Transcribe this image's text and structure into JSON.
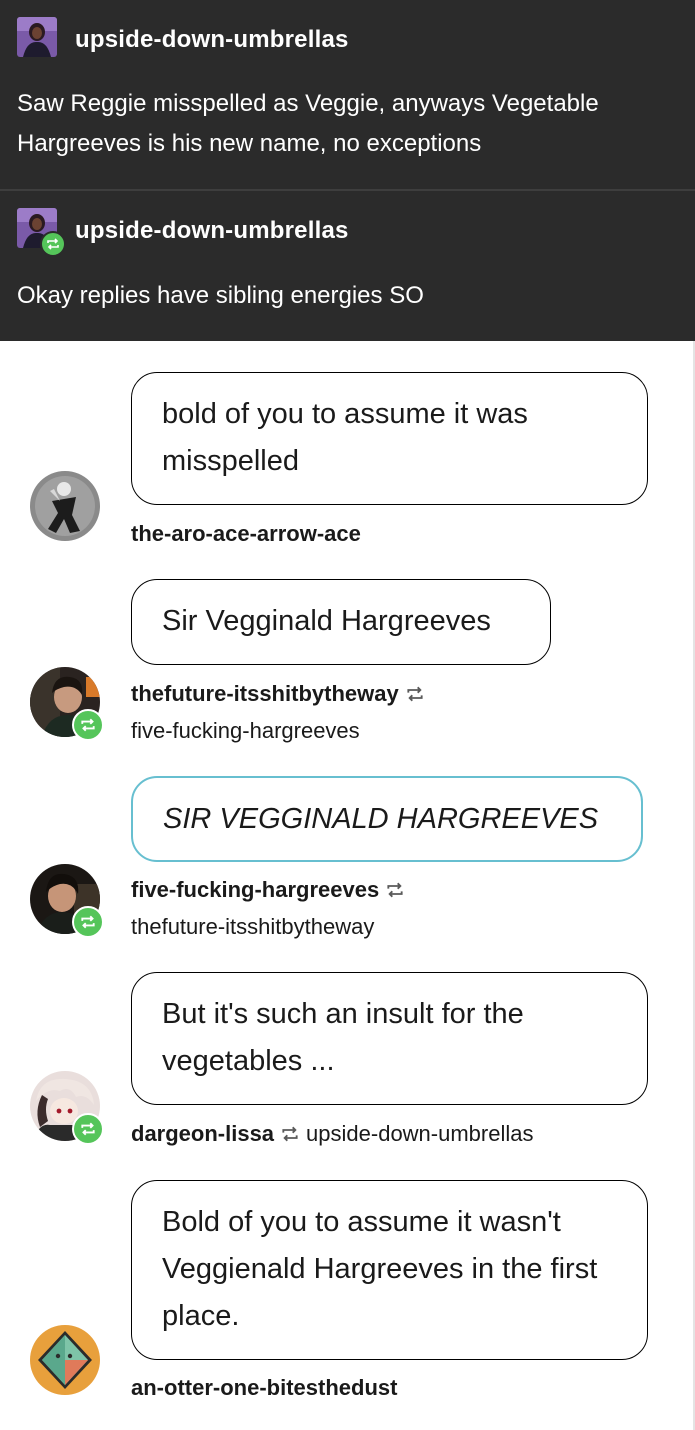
{
  "post1": {
    "username": "upside-down-umbrellas",
    "text": "Saw Reggie misspelled as Veggie, anyways Vegetable Hargreeves is his new name, no exceptions"
  },
  "post2": {
    "username": "upside-down-umbrellas",
    "text": "Okay replies have sibling energies SO"
  },
  "replies": [
    {
      "text": "bold of you to assume it was misspelled",
      "username": "the-aro-ace-arrow-ace"
    },
    {
      "text": "Sir Vegginald Hargreeves",
      "username": "thefuture-itsshitbytheway",
      "reblogged_from": "five-fucking-hargreeves"
    },
    {
      "text": "SIR VEGGINALD HARGREEVES",
      "username": "five-fucking-hargreeves",
      "reblogged_from": "thefuture-itsshitbytheway"
    },
    {
      "text": "But it's such an insult for the vegetables ...",
      "username": "dargeon-lissa",
      "reblogged_from": "upside-down-umbrellas"
    },
    {
      "text": "Bold of you to assume it wasn't Veggienald Hargreeves in the first place.",
      "username": "an-otter-one-bitesthedust"
    }
  ],
  "colors": {
    "dark_bg": "#2b2b2b",
    "reblog_green": "#55c55a",
    "highlight_border": "#67bfd0"
  },
  "icons": [
    "reblog-icon",
    "avatar"
  ]
}
